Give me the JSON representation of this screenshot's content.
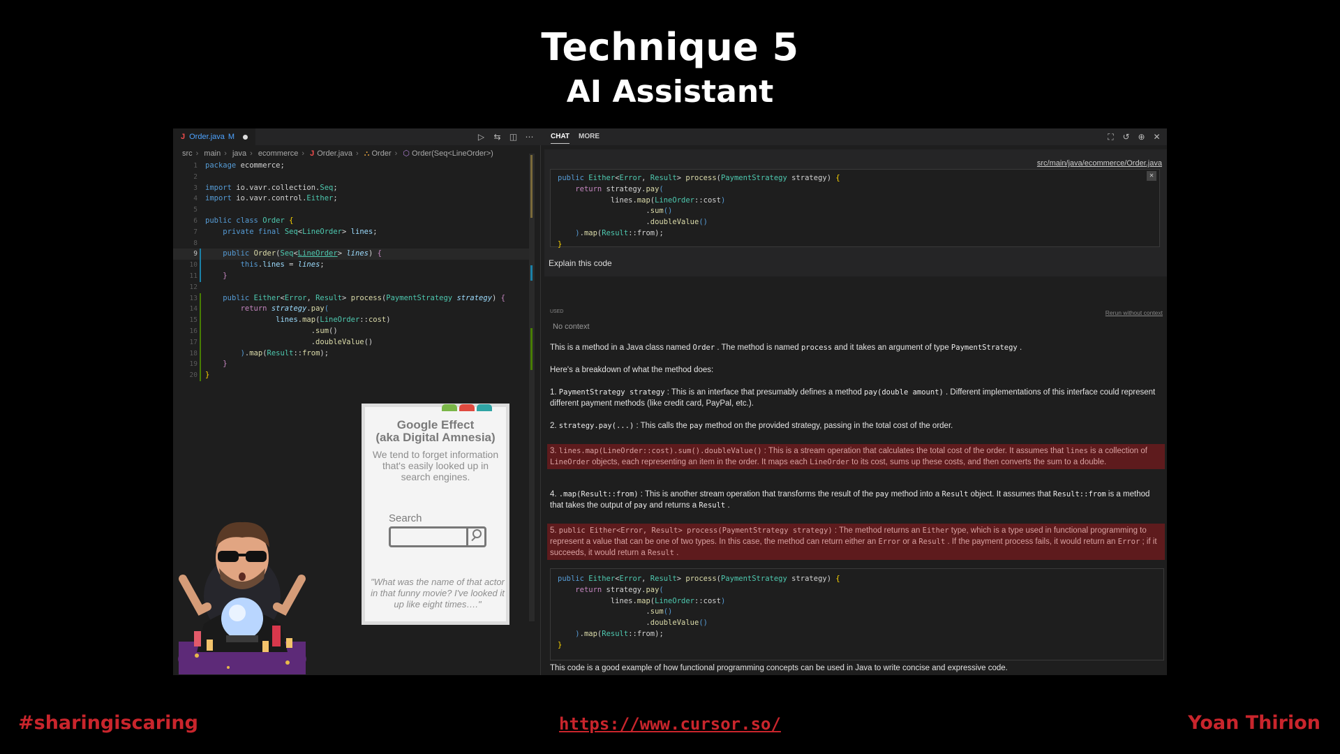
{
  "slide": {
    "title": "Technique 5",
    "subtitle": "AI Assistant",
    "hashtag": "#sharingiscaring",
    "url": "https://www.cursor.so/",
    "author": "Yoan Thirion"
  },
  "editor": {
    "tab": {
      "icon_letter": "J",
      "name": "Order.java",
      "status": "M"
    },
    "breadcrumb": [
      "src",
      "main",
      "java",
      "ecommerce",
      "Order.java",
      "Order",
      "Order(Seq<LineOrder>)"
    ],
    "line_numbers": [
      "1",
      "2",
      "3",
      "4",
      "5",
      "6",
      "7",
      "8",
      "9",
      "10",
      "11",
      "12",
      "13",
      "14",
      "15",
      "16",
      "17",
      "18",
      "19",
      "20"
    ],
    "actions": [
      "run-icon",
      "compare-icon",
      "split-editor-icon",
      "more-icon"
    ]
  },
  "chat": {
    "tabs": [
      "CHAT",
      "MORE"
    ],
    "file_path": "src/main/java/ecommerce/Order.java",
    "query": "Explain this code",
    "used_label": "USED",
    "rerun_label": "Rerun without context",
    "no_context": "No context",
    "closing": "This code is a good example of how functional programming concepts can be used in Java to write concise and expressive code."
  },
  "card": {
    "title_line1": "Google Effect",
    "title_line2": "(aka Digital Amnesia)",
    "body": "We tend to forget information that's easily looked up in search engines.",
    "search_label": "Search",
    "quote": "\"What was the name of that actor in that funny movie? I've looked it up like eight times….\""
  }
}
